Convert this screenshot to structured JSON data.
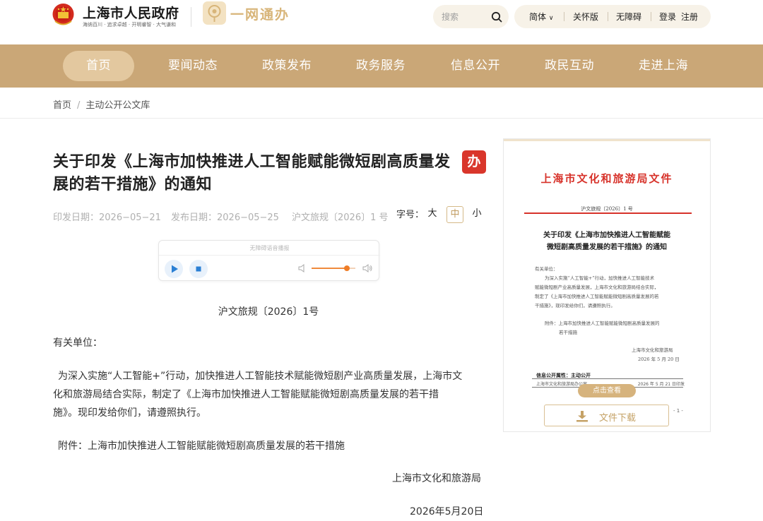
{
  "header": {
    "site_title": "上海市人民政府",
    "motto": "海纳百川 · 追求卓越 · 开明睿智 · 大气谦和",
    "service_logo_text": "一网通办",
    "search_placeholder": "搜索",
    "utilities": {
      "language": "简体",
      "elder_mode": "关怀版",
      "accessibility": "无障碍",
      "login": "登录",
      "register": "注册"
    }
  },
  "nav": {
    "items": [
      "首页",
      "要闻动态",
      "政策发布",
      "政务服务",
      "信息公开",
      "政民互动",
      "走进上海"
    ],
    "active_index": 0
  },
  "breadcrumb": [
    "首页",
    "主动公开公文库"
  ],
  "article": {
    "title": "关于印发《上海市加快推进人工智能赋能微短剧高质量发展的若干措施》的通知",
    "badge": "办",
    "issue_date": "印发日期：2026−05−21",
    "publish_date": "发布日期：2026−05−25",
    "doc_no": "沪文旅规〔2026〕1 号",
    "font_size_label": "字号：",
    "font_sizes": [
      "大",
      "中",
      "小"
    ],
    "font_size_selected": "中",
    "player_label": "无障碍语音播报",
    "player_volume": 0.8,
    "doc_no_center": "沪文旅规〔2026〕1号",
    "recipient": "有关单位：",
    "body_line1": "为深入实施“人工智能+”行动，加快推进人工智能技术赋能微短剧产业高质量发展，上海市文",
    "body_line2": "化和旅游局结合实际，制定了《上海市加快推进人工智能赋能微短剧高质量发展的若干措",
    "body_line3": "施》。现印发给你们，请遵照执行。",
    "attachment": "附件：上海市加快推进人工智能赋能微短剧高质量发展的若干措施",
    "signer": "上海市文化和旅游局",
    "sign_date": "2026年5月20日"
  },
  "preview": {
    "head": "上海市文化和旅游局文件",
    "doc_no": "沪文旅规〔2026〕1 号",
    "title_line1": "关于印发《上海市加快推进人工智能赋能",
    "title_line2": "微短剧高质量发展的若干措施》的通知",
    "recipient": "有关单位：",
    "p1": "为深入实施“人工智能+”行动，加快推进人工智能技术",
    "p2": "赋能微短剧产业高质量发展，上海市文化和旅游局结合实际，",
    "p3": "制定了《上海市加快推进人工智能赋能微短剧高质量发展的若",
    "p4": "干措施》，现印发给你们，请遵照执行。",
    "att1": "附件：上海市加快推进人工智能赋能微短剧高质量发展的",
    "att2": "若干措施",
    "signer": "上海市文化和旅游局",
    "date": "2026 年 5 月 20 日",
    "attr_label": "信息公开属性：主动公开",
    "attr_row_left": "上海市文化和旅游局办公室",
    "attr_row_right": "2026 年 5 月 21 日印发",
    "view_button": "点击查看",
    "download_button": "文件下载",
    "page_no": "- 1 -"
  }
}
